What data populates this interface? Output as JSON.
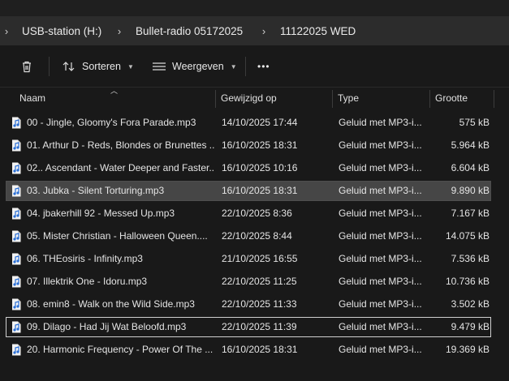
{
  "breadcrumb": [
    "USB-station (H:)",
    "Bullet-radio 05172025",
    "11122025 WED"
  ],
  "toolbar": {
    "delete_icon": "trash-icon",
    "sort_label": "Sorteren",
    "view_label": "Weergeven",
    "more_label": "•••"
  },
  "columns": {
    "name": "Naam",
    "modified": "Gewijzigd op",
    "type": "Type",
    "size": "Grootte"
  },
  "files": [
    {
      "name": "00 - Jingle, Gloomy's Fora Parade.mp3",
      "modified": "14/10/2025 17:44",
      "type": "Geluid met MP3-i...",
      "size": "575 kB"
    },
    {
      "name": "01. Arthur D - Reds, Blondes or Brunettes ...",
      "modified": "16/10/2025 18:31",
      "type": "Geluid met MP3-i...",
      "size": "5.964 kB"
    },
    {
      "name": "02.. Ascendant - Water Deeper and Faster...",
      "modified": "16/10/2025 10:16",
      "type": "Geluid met MP3-i...",
      "size": "6.604 kB"
    },
    {
      "name": "03. Jubka - Silent Torturing.mp3",
      "modified": "16/10/2025 18:31",
      "type": "Geluid met MP3-i...",
      "size": "9.890 kB"
    },
    {
      "name": "04. jbakerhill 92 - Messed Up.mp3",
      "modified": "22/10/2025 8:36",
      "type": "Geluid met MP3-i...",
      "size": "7.167 kB"
    },
    {
      "name": "05. Mister Christian - Halloween Queen....",
      "modified": "22/10/2025 8:44",
      "type": "Geluid met MP3-i...",
      "size": "14.075 kB"
    },
    {
      "name": "06. THEosiris - Infinity.mp3",
      "modified": "21/10/2025 16:55",
      "type": "Geluid met MP3-i...",
      "size": "7.536 kB"
    },
    {
      "name": "07. Illektrik One - Idoru.mp3",
      "modified": "22/10/2025 11:25",
      "type": "Geluid met MP3-i...",
      "size": "10.736 kB"
    },
    {
      "name": "08. emin8 - Walk on the Wild Side.mp3",
      "modified": "22/10/2025 11:33",
      "type": "Geluid met MP3-i...",
      "size": "3.502 kB"
    },
    {
      "name": "09. Dilago - Had Jij Wat Beloofd.mp3",
      "modified": "22/10/2025 11:39",
      "type": "Geluid met MP3-i...",
      "size": "9.479 kB"
    },
    {
      "name": "20. Harmonic Frequency - Power Of The ...",
      "modified": "16/10/2025 18:31",
      "type": "Geluid met MP3-i...",
      "size": "19.369 kB"
    }
  ],
  "selected_rows": [
    3
  ],
  "focused_rows": [
    9
  ],
  "colors": {
    "accent": "#4a90d9",
    "selected_bg": "#464646"
  }
}
